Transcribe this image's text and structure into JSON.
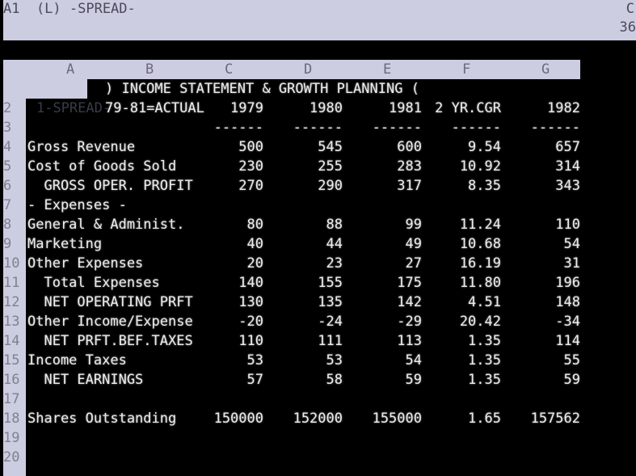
{
  "colors": {
    "background": "#000000",
    "text": "#ececec",
    "highlight": "#cccde0"
  },
  "status": {
    "cell_info": "A1  (L) -SPREAD-",
    "column_indicator": "C",
    "memory": "36"
  },
  "column_headers": [
    "A",
    "B",
    "C",
    "D",
    "E",
    "F",
    "G"
  ],
  "row_numbers": [
    "1",
    "2",
    "3",
    "4",
    "5",
    "6",
    "7",
    "8",
    "9",
    "10",
    "11",
    "12",
    "13",
    "14",
    "15",
    "16",
    "17",
    "18",
    "19",
    "20"
  ],
  "sheet": {
    "a1_cell": "-SPREAD-",
    "title": ") INCOME STATEMENT & GROWTH PLANNING (",
    "header_row": [
      "79-81=ACTUAL",
      "1979",
      "1980",
      "1981",
      "2 YR.CGR",
      "1982"
    ],
    "underline_row": [
      "------",
      "------",
      "------",
      "------",
      "------"
    ],
    "rows": [
      {
        "label": "Gross Revenue",
        "values": [
          "500",
          "545",
          "600",
          "9.54",
          "657"
        ]
      },
      {
        "label": "Cost of Goods Sold",
        "values": [
          "230",
          "255",
          "283",
          "10.92",
          "314"
        ]
      },
      {
        "label": "  GROSS OPER. PROFIT",
        "values": [
          "270",
          "290",
          "317",
          "8.35",
          "343"
        ]
      },
      {
        "label": "- Expenses -",
        "values": []
      },
      {
        "label": "General & Administ.",
        "values": [
          "80",
          "88",
          "99",
          "11.24",
          "110"
        ]
      },
      {
        "label": "Marketing",
        "values": [
          "40",
          "44",
          "49",
          "10.68",
          "54"
        ]
      },
      {
        "label": "Other Expenses",
        "values": [
          "20",
          "23",
          "27",
          "16.19",
          "31"
        ]
      },
      {
        "label": "  Total Expenses",
        "values": [
          "140",
          "155",
          "175",
          "11.80",
          "196"
        ]
      },
      {
        "label": "  NET OPERATING PRFT",
        "values": [
          "130",
          "135",
          "142",
          "4.51",
          "148"
        ]
      },
      {
        "label": "Other Income/Expense",
        "values": [
          "-20",
          "-24",
          "-29",
          "20.42",
          "-34"
        ]
      },
      {
        "label": "  NET PRFT.BEF.TAXES",
        "values": [
          "110",
          "111",
          "113",
          "1.35",
          "114"
        ]
      },
      {
        "label": "Income Taxes",
        "values": [
          "53",
          "53",
          "54",
          "1.35",
          "55"
        ]
      },
      {
        "label": "  NET EARNINGS",
        "values": [
          "57",
          "58",
          "59",
          "1.35",
          "59"
        ]
      },
      {
        "label": "",
        "values": []
      },
      {
        "label": "Shares Outstanding",
        "values": [
          "150000",
          "152000",
          "155000",
          "1.65",
          "157562"
        ]
      },
      {
        "label": "",
        "values": []
      },
      {
        "label": "",
        "values": []
      }
    ]
  }
}
